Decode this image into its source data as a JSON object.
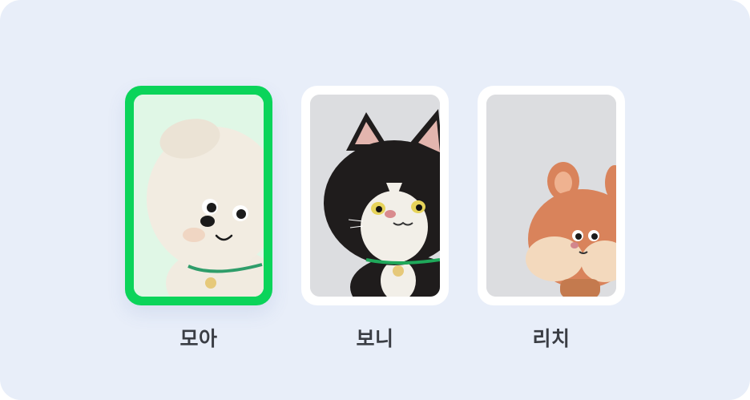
{
  "characters": [
    {
      "name": "모아",
      "avatar_icon": "moa-puppy-avatar",
      "selected": true
    },
    {
      "name": "보니",
      "avatar_icon": "boni-cat-avatar",
      "selected": false
    },
    {
      "name": "리치",
      "avatar_icon": "richi-fox-avatar",
      "selected": false
    }
  ],
  "colors": {
    "selected_border": "#0bd45a",
    "panel_background": "#e8eef9",
    "label_text": "#3a3d44"
  }
}
